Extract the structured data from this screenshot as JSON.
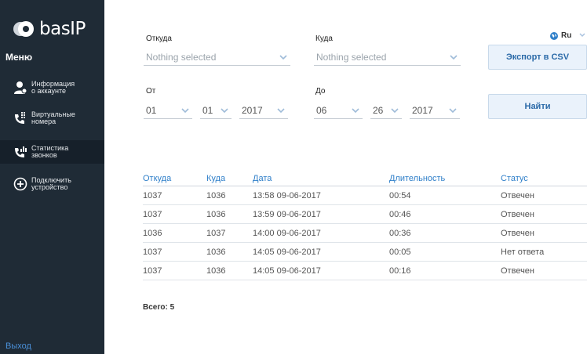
{
  "brand": {
    "logo_text": "basIP"
  },
  "sidebar": {
    "menu_title": "Меню",
    "items": [
      {
        "label": "Информация\nо аккаунте",
        "icon": "user-icon"
      },
      {
        "label": "Виртуальные\nномера",
        "icon": "phone-grid-icon"
      },
      {
        "label": "Статистика\nзвонков",
        "icon": "phone-stats-icon",
        "active": true
      },
      {
        "label": "Подключить\nустройство",
        "icon": "plus-circle-icon"
      }
    ],
    "logout": "Выход"
  },
  "language": {
    "value": "Ru"
  },
  "filters": {
    "from_label": "Откуда",
    "from_placeholder": "Nothing selected",
    "to_label": "Куда",
    "to_placeholder": "Nothing selected",
    "date_from_label": "От",
    "date_from": {
      "month": "01",
      "day": "01",
      "year": "2017"
    },
    "date_to_label": "До",
    "date_to": {
      "month": "06",
      "day": "26",
      "year": "2017"
    },
    "export_label": "Экспорт в CSV",
    "search_label": "Найти"
  },
  "table": {
    "headers": [
      "Откуда",
      "Куда",
      "Дата",
      "Длительность",
      "Статус"
    ],
    "rows": [
      [
        "1037",
        "1036",
        "13:58 09-06-2017",
        "00:54",
        "Отвечен"
      ],
      [
        "1037",
        "1036",
        "13:59 09-06-2017",
        "00:46",
        "Отвечен"
      ],
      [
        "1036",
        "1037",
        "14:00 09-06-2017",
        "00:36",
        "Отвечен"
      ],
      [
        "1037",
        "1036",
        "14:05 09-06-2017",
        "00:05",
        "Нет ответа"
      ],
      [
        "1037",
        "1036",
        "14:05 09-06-2017",
        "00:16",
        "Отвечен"
      ]
    ]
  },
  "total": "Всего: 5",
  "colors": {
    "sidebar": "#1f2b36",
    "accent": "#2f7fc9",
    "button_bg": "#eaf2fb"
  }
}
